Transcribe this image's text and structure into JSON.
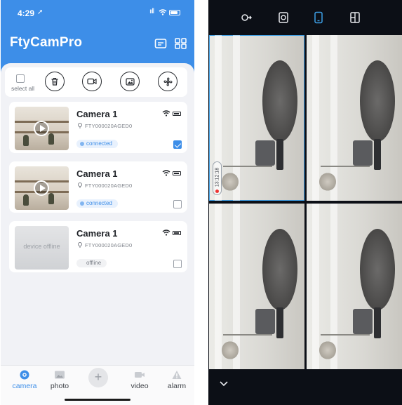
{
  "status_bar": {
    "time": "4:29",
    "location_glyph": "➚",
    "signal_glyph": "ııll"
  },
  "app": {
    "title": "FtyCamPro"
  },
  "header_icons": {
    "message": "message-icon",
    "grid": "grid-icon"
  },
  "toolbar": {
    "select_all_label": "select all",
    "buttons": [
      "trash-icon",
      "record-icon",
      "image-icon",
      "fan-icon"
    ]
  },
  "cameras": [
    {
      "name": "Camera 1",
      "id": "FTY000020AGED0",
      "status": "connected",
      "thumbnail": "live",
      "checked": true
    },
    {
      "name": "Camera 1",
      "id": "FTY000020AGED0",
      "status": "connected",
      "thumbnail": "live",
      "checked": false
    },
    {
      "name": "Camera 1",
      "id": "FTY000020AGED0",
      "status": "offline",
      "thumbnail": "offline",
      "offline_text": "device offline",
      "checked": false
    }
  ],
  "tabs": [
    {
      "label": "camera",
      "icon": "camera-icon",
      "active": true
    },
    {
      "label": "photo",
      "icon": "photo-icon",
      "active": false
    },
    {
      "label": "+",
      "icon": "plus-icon",
      "active": false
    },
    {
      "label": "video",
      "icon": "video-icon",
      "active": false
    },
    {
      "label": "alarm",
      "icon": "alarm-icon",
      "active": false
    }
  ],
  "viewer": {
    "top_icons": [
      "rotate-icon",
      "snapshot-icon",
      "phone-icon",
      "layout-icon"
    ],
    "active_top_icon": 2,
    "timestamp": "13:12:18",
    "collapse_icon": "chevron-down-icon"
  },
  "colors": {
    "brand": "#3d8ee8",
    "viewer_bg": "#0c0f16",
    "selection": "#3d9fe6"
  }
}
